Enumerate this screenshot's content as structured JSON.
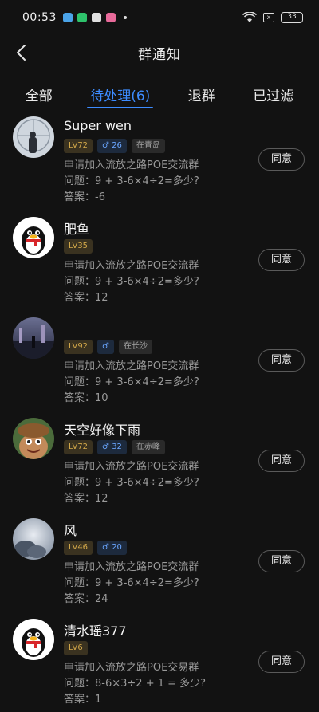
{
  "status": {
    "time": "00:53",
    "battery": "33",
    "x_box": "x"
  },
  "header": {
    "title": "群通知"
  },
  "tabs": [
    {
      "label": "全部"
    },
    {
      "label": "待处理(6)"
    },
    {
      "label": "退群"
    },
    {
      "label": "已过滤"
    }
  ],
  "colors": {
    "accent": "#3d8cff",
    "background": "#121212",
    "level_tag": "#d4a94a",
    "gender_tag": "#6aa6ff"
  },
  "requests": [
    {
      "name": "Super wen",
      "level": "LV72",
      "gender": "♂ 26",
      "location": "在青岛",
      "apply": "申请加入流放之路POE交流群",
      "question": "问题：9 + 3-6×4÷2=多少?",
      "answer": "答案：-6",
      "button": "同意"
    },
    {
      "name": "肥鱼",
      "level": "LV35",
      "apply": "申请加入流放之路POE交流群",
      "question": "问题：9 + 3-6×4÷2=多少?",
      "answer": "答案：12",
      "button": "同意"
    },
    {
      "name": "",
      "level": "LV92",
      "gender": "♂",
      "location": "在长沙",
      "apply": "申请加入流放之路POE交流群",
      "question": "问题：9 + 3-6×4÷2=多少?",
      "answer": "答案：10",
      "button": "同意"
    },
    {
      "name": "天空好像下雨",
      "level": "LV72",
      "gender": "♂ 32",
      "location": "在赤峰",
      "apply": "申请加入流放之路POE交流群",
      "question": "问题：9 + 3-6×4÷2=多少?",
      "answer": "答案：12",
      "button": "同意"
    },
    {
      "name": "风",
      "level": "LV46",
      "gender": "♂ 20",
      "apply": "申请加入流放之路POE交流群",
      "question": "问题：9 + 3-6×4÷2=多少?",
      "answer": "答案：24",
      "button": "同意"
    },
    {
      "name": "清水瑶377",
      "level": "LV6",
      "apply": "申请加入流放之路POE交易群",
      "question": "问题：8-6×3÷2 + 1 = 多少?",
      "answer": "答案：1",
      "button": "同意"
    }
  ]
}
